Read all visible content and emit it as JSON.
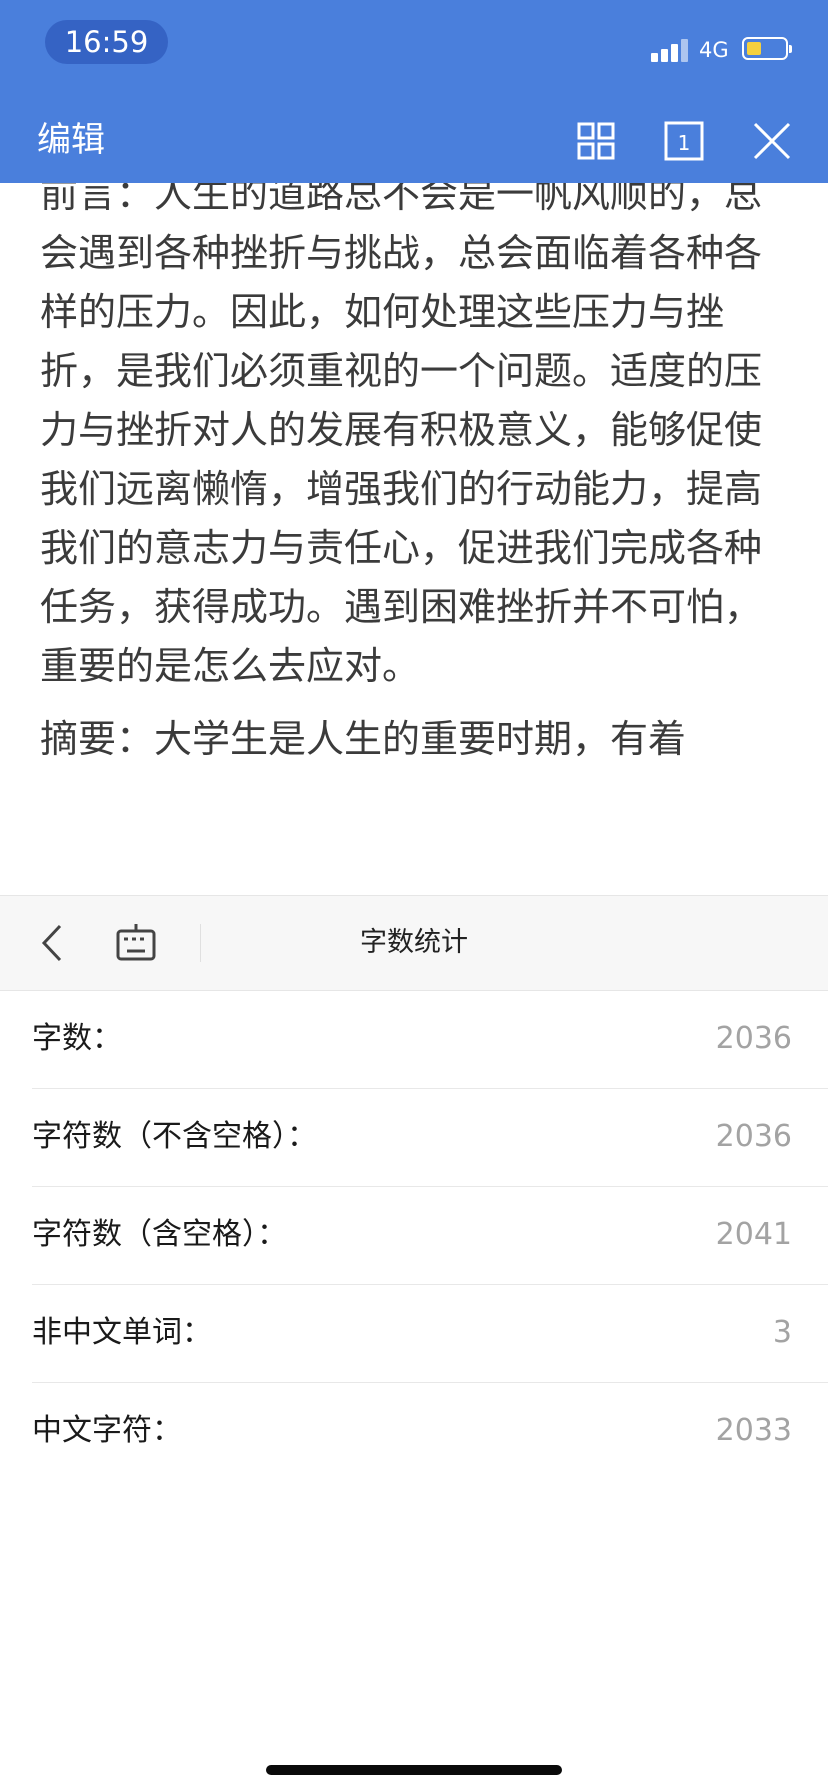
{
  "status_bar": {
    "time": "16:59",
    "network": "4G",
    "battery_level": 0.4,
    "battery_color": "#f4d03f"
  },
  "header": {
    "title": "编辑",
    "background": "#4a7fdc",
    "icons": [
      "grid-view-icon",
      "single-page-icon",
      "close-icon"
    ],
    "page_indicator": "1"
  },
  "document": {
    "paragraphs": [
      "前言：人生的道路总不会是一帆风顺的，总会遇到各种挫折与挑战，总会面临着各种各样的压力。因此，如何处理这些压力与挫折，是我们必须重视的一个问题。适度的压力与挫折对人的发展有积极意义，能够促使我们远离懒惰，增强我们的行动能力，提高我们的意志力与责任心，促进我们完成各种任务，获得成功。遇到困难挫折并不可怕，重要的是怎么去应对。",
      "摘要：大学生是人生的重要时期，有着"
    ]
  },
  "word_count_panel": {
    "title": "字数统计",
    "toolbar_icons": [
      "back-chevron-icon",
      "keyboard-icon"
    ],
    "rows": [
      {
        "label": "字数：",
        "value": "2036"
      },
      {
        "label": "字符数（不含空格）：",
        "value": "2036"
      },
      {
        "label": "字符数（含空格）：",
        "value": "2041"
      },
      {
        "label": "非中文单词：",
        "value": "3"
      },
      {
        "label": "中文字符：",
        "value": "2033"
      }
    ]
  }
}
